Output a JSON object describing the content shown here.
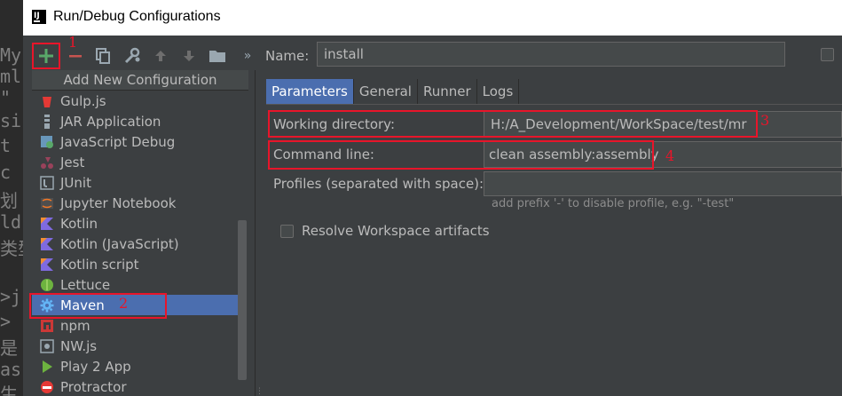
{
  "window": {
    "title": "Run/Debug Configurations"
  },
  "background_editor": {
    "lines": [
      "My",
      "ml",
      "\"",
      "si",
      "t",
      "c",
      "划",
      "ld",
      "类型",
      ">j",
      ">",
      "是",
      "as",
      "生"
    ]
  },
  "toolbar": {
    "add_icon": "plus-icon",
    "remove_icon": "minus-icon",
    "copy_icon": "copy-icon",
    "edit_defaults_icon": "wrench-icon",
    "move_up_icon": "arrow-up-icon",
    "move_down_icon": "arrow-down-icon",
    "folder_icon": "folder-icon",
    "more_label": "»"
  },
  "annotations": {
    "a1": "1",
    "a2": "2",
    "a3": "3",
    "a4": "4"
  },
  "tree": {
    "header": "Add New Configuration",
    "items": [
      {
        "label": "Gulp.js",
        "icon": "gulp-icon",
        "color": "#e53935"
      },
      {
        "label": "JAR Application",
        "icon": "jar-icon",
        "color": "#9aa7b0"
      },
      {
        "label": "JavaScript Debug",
        "icon": "js-debug-icon",
        "color": "#6897bb"
      },
      {
        "label": "Jest",
        "icon": "jest-icon",
        "color": "#99425b"
      },
      {
        "label": "JUnit",
        "icon": "junit-icon",
        "color": "#9aa7b0"
      },
      {
        "label": "Jupyter Notebook",
        "icon": "jupyter-icon",
        "color": "#f37726"
      },
      {
        "label": "Kotlin",
        "icon": "kotlin-icon",
        "color": "#7f6ae0"
      },
      {
        "label": "Kotlin (JavaScript)",
        "icon": "kotlin-js-icon",
        "color": "#7f6ae0"
      },
      {
        "label": "Kotlin script",
        "icon": "kotlin-script-icon",
        "color": "#7f6ae0"
      },
      {
        "label": "Lettuce",
        "icon": "lettuce-icon",
        "color": "#6db33f"
      },
      {
        "label": "Maven",
        "icon": "maven-gear-icon",
        "color": "#2196f3",
        "selected": true
      },
      {
        "label": "npm",
        "icon": "npm-icon",
        "color": "#cb3837"
      },
      {
        "label": "NW.js",
        "icon": "nwjs-icon",
        "color": "#9aa7b0"
      },
      {
        "label": "Play 2 App",
        "icon": "play-icon",
        "color": "#6db33f"
      },
      {
        "label": "Protractor",
        "icon": "protractor-icon",
        "color": "#e53935"
      }
    ]
  },
  "form": {
    "name_label": "Name:",
    "name_value": "install",
    "tabs": [
      "Parameters",
      "General",
      "Runner",
      "Logs"
    ],
    "active_tab": "Parameters",
    "working_dir_label": "Working directory:",
    "working_dir_value": "H:/A_Development/WorkSpace/test/mr",
    "command_line_label": "Command line:",
    "command_line_value": "clean assembly:assembly",
    "profiles_label": "Profiles (separated with space):",
    "profiles_value": "",
    "profiles_hint": "add prefix '-' to disable profile, e.g. \"-test\"",
    "resolve_label": "Resolve Workspace artifacts",
    "resolve_checked": false
  },
  "colors": {
    "accent": "#4b6eaf",
    "annotation": "#e8152a",
    "add_green": "#59a869"
  }
}
